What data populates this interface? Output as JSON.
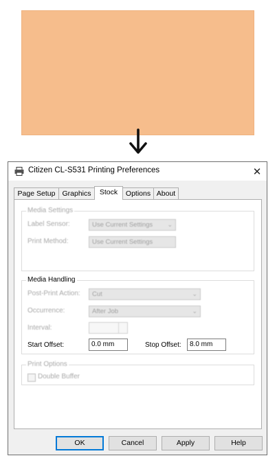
{
  "label_sample": {
    "color": "#f6bd8c"
  },
  "arrow": {
    "icon": "arrow-down-icon"
  },
  "window": {
    "title": "Citizen CL-S531 Printing Preferences",
    "title_icon": "printer-icon",
    "close_glyph": "✕"
  },
  "tabs": [
    {
      "label": "Page Setup",
      "active": false
    },
    {
      "label": "Graphics",
      "active": false
    },
    {
      "label": "Stock",
      "active": true
    },
    {
      "label": "Options",
      "active": false
    },
    {
      "label": "About",
      "active": false
    }
  ],
  "media_settings": {
    "title": "Media Settings",
    "label_sensor_label": "Label Sensor:",
    "label_sensor_value": "Use Current Settings",
    "print_method_label": "Print Method:",
    "print_method_value": "Use Current Settings"
  },
  "media_handling": {
    "title": "Media Handling",
    "post_print_action_label": "Post-Print Action:",
    "post_print_action_value": "Cut",
    "occurrence_label": "Occurrence:",
    "occurrence_value": "After Job",
    "interval_label": "Interval:",
    "start_offset_label": "Start Offset:",
    "start_offset_value": "0.0 mm",
    "stop_offset_label": "Stop Offset:",
    "stop_offset_value": "8.0 mm"
  },
  "print_options": {
    "title": "Print Options",
    "double_buffer_label": "Double Buffer"
  },
  "buttons": {
    "ok": "OK",
    "cancel": "Cancel",
    "apply": "Apply",
    "help": "Help"
  }
}
